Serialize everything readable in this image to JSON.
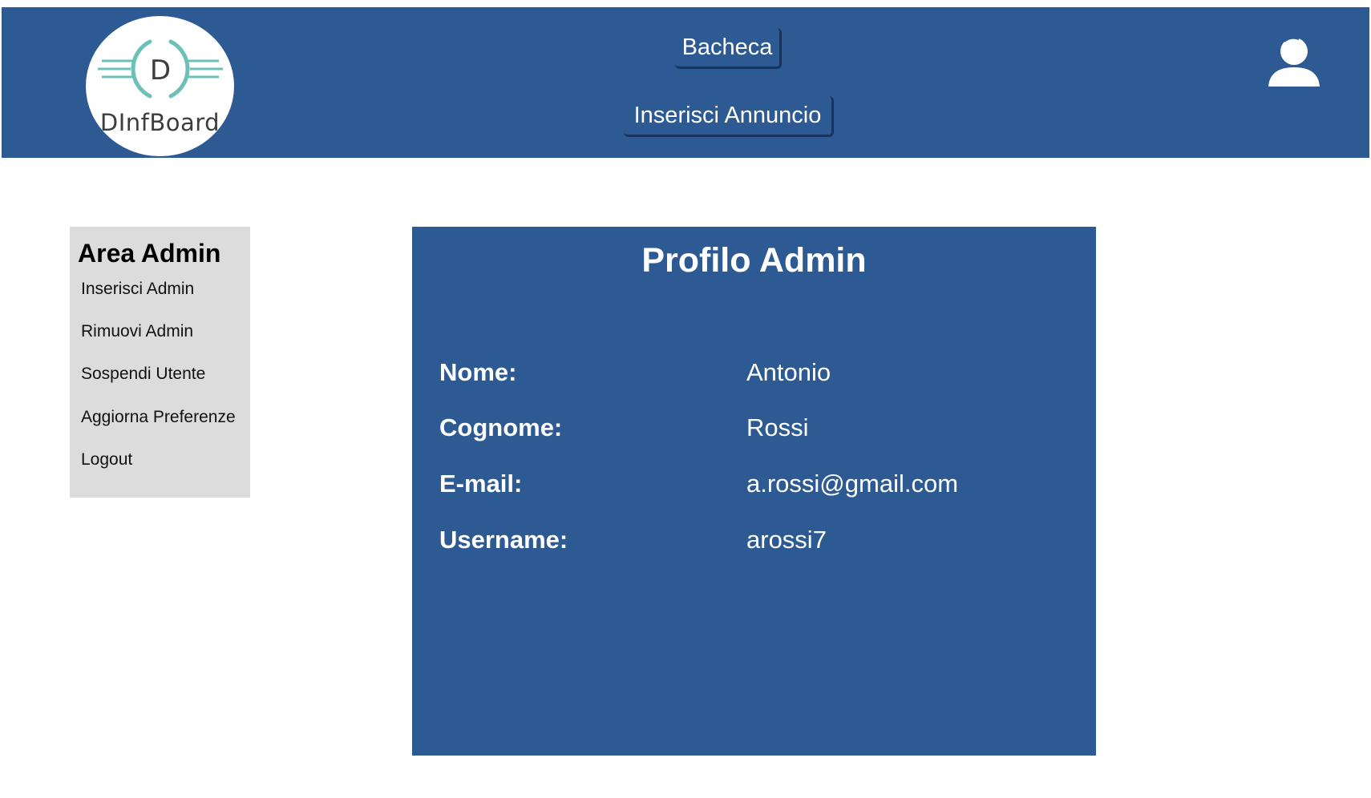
{
  "header": {
    "logo_text": "DInfBoard",
    "nav": {
      "bacheca": "Bacheca",
      "inserisci_annuncio": "Inserisci Annuncio"
    },
    "user_icon": "user-icon"
  },
  "sidebar": {
    "title": "Area Admin",
    "items": [
      {
        "label": "Inserisci Admin"
      },
      {
        "label": "Rimuovi Admin"
      },
      {
        "label": "Sospendi Utente"
      },
      {
        "label": "Aggiorna Preferenze"
      },
      {
        "label": "Logout"
      }
    ]
  },
  "profile": {
    "title": "Profilo Admin",
    "fields": [
      {
        "label": "Nome:",
        "value": "Antonio"
      },
      {
        "label": "Cognome:",
        "value": "Rossi"
      },
      {
        "label": "E-mail:",
        "value": "a.rossi@gmail.com"
      },
      {
        "label": "Username:",
        "value": "arossi7"
      }
    ]
  },
  "colors": {
    "brand_blue": "#2d5a93",
    "sidebar_bg": "#dcdcdc",
    "logo_teal": "#6cc0b8"
  }
}
